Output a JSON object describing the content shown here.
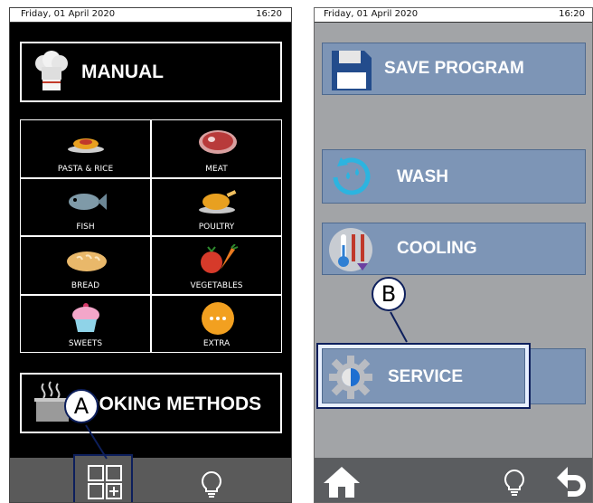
{
  "left_screen": {
    "status": {
      "date": "Friday, 01 April 2020",
      "time": "16:20"
    },
    "manual_label": "MANUAL",
    "categories": [
      {
        "label": "PASTA & RICE",
        "icon": "pasta-icon"
      },
      {
        "label": "MEAT",
        "icon": "meat-icon"
      },
      {
        "label": "FISH",
        "icon": "fish-icon"
      },
      {
        "label": "POULTRY",
        "icon": "poultry-icon"
      },
      {
        "label": "BREAD",
        "icon": "bread-icon"
      },
      {
        "label": "VEGETABLES",
        "icon": "vegetables-icon"
      },
      {
        "label": "SWEETS",
        "icon": "cupcake-icon"
      },
      {
        "label": "EXTRA",
        "icon": "more-icon"
      }
    ],
    "cooking_methods_label": "COOKING METHODS",
    "bottom_icons": [
      "apps-add-icon",
      "lightbulb-icon"
    ]
  },
  "right_screen": {
    "status": {
      "date": "Friday, 01 April 2020",
      "time": "16:20"
    },
    "buttons": {
      "save_program": "SAVE PROGRAM",
      "wash": "WASH",
      "cooling": "COOLING",
      "service": "SERVICE"
    },
    "bottom_icons": [
      "home-icon",
      "lightbulb-icon",
      "undo-icon"
    ]
  },
  "callouts": {
    "a": "A",
    "b": "B"
  },
  "colors": {
    "left_bg": "#000000",
    "right_bg": "#a2a4a7",
    "button_blue": "#7d95b6",
    "callout_border": "#0d1f5c",
    "highlight": "#e8f0ff"
  }
}
